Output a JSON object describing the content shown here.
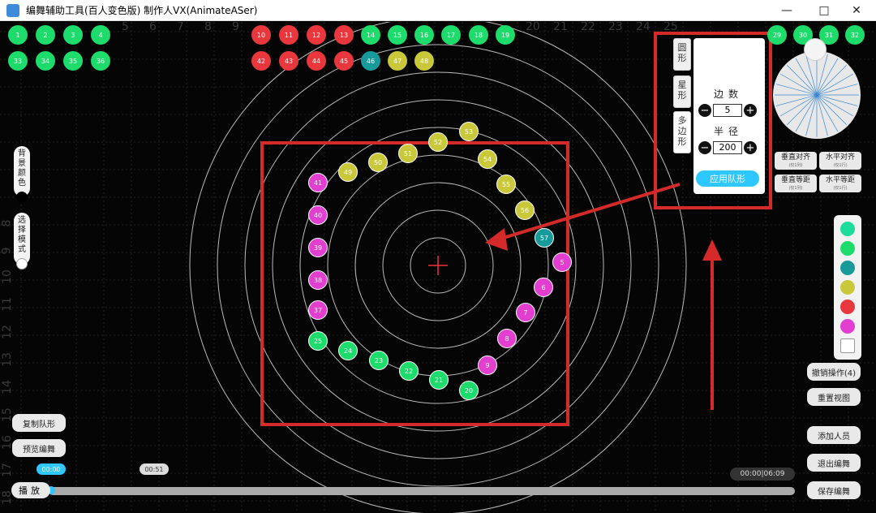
{
  "window": {
    "title": "编舞辅助工具(百人变色版)  制作人VX(AnimateASer)",
    "minimize_icon": "minimize-icon",
    "maximize_icon": "maximize-icon",
    "close_icon": "close-icon"
  },
  "axis": {
    "top_labels": [
      "5",
      "6",
      "7",
      "8",
      "9",
      "20",
      "21",
      "22",
      "23",
      "24",
      "25"
    ],
    "left_labels": [
      "8",
      "9",
      "10",
      "11",
      "12",
      "13",
      "14",
      "15",
      "16",
      "17",
      "18"
    ]
  },
  "dancers": [
    {
      "n": "1",
      "c": "#1ddc6c"
    },
    {
      "n": "2",
      "c": "#1ddc6c"
    },
    {
      "n": "3",
      "c": "#1ddc6c"
    },
    {
      "n": "4",
      "c": "#1ddc6c"
    },
    {
      "n": "10",
      "c": "#e8383d"
    },
    {
      "n": "11",
      "c": "#e8383d"
    },
    {
      "n": "12",
      "c": "#e8383d"
    },
    {
      "n": "13",
      "c": "#e8383d"
    },
    {
      "n": "14",
      "c": "#1ddc6c"
    },
    {
      "n": "15",
      "c": "#1ddc6c"
    },
    {
      "n": "16",
      "c": "#1ddc6c"
    },
    {
      "n": "17",
      "c": "#1ddc6c"
    },
    {
      "n": "18",
      "c": "#1ddc6c"
    },
    {
      "n": "19",
      "c": "#1ddc6c"
    },
    {
      "n": "33",
      "c": "#1ddc6c"
    },
    {
      "n": "34",
      "c": "#1ddc6c"
    },
    {
      "n": "35",
      "c": "#1ddc6c"
    },
    {
      "n": "36",
      "c": "#1ddc6c"
    },
    {
      "n": "42",
      "c": "#e8383d"
    },
    {
      "n": "43",
      "c": "#e8383d"
    },
    {
      "n": "44",
      "c": "#e8383d"
    },
    {
      "n": "45",
      "c": "#e8383d"
    },
    {
      "n": "46",
      "c": "#179a9a"
    },
    {
      "n": "47",
      "c": "#c9c83a"
    },
    {
      "n": "48",
      "c": "#c9c83a"
    },
    {
      "n": "29",
      "c": "#1ddc6c"
    },
    {
      "n": "30",
      "c": "#1ddc6c"
    },
    {
      "n": "31",
      "c": "#1ddc6c"
    },
    {
      "n": "32",
      "c": "#1ddc6c"
    },
    {
      "n": "53",
      "c": "#c9c83a"
    },
    {
      "n": "52",
      "c": "#c9c83a"
    },
    {
      "n": "51",
      "c": "#c9c83a"
    },
    {
      "n": "50",
      "c": "#c9c83a"
    },
    {
      "n": "49",
      "c": "#c9c83a"
    },
    {
      "n": "54",
      "c": "#c9c83a"
    },
    {
      "n": "55",
      "c": "#c9c83a"
    },
    {
      "n": "56",
      "c": "#c9c83a"
    },
    {
      "n": "57",
      "c": "#179a9a"
    },
    {
      "n": "5",
      "c": "#e23fd0"
    },
    {
      "n": "6",
      "c": "#e23fd0"
    },
    {
      "n": "7",
      "c": "#e23fd0"
    },
    {
      "n": "8",
      "c": "#e23fd0"
    },
    {
      "n": "9",
      "c": "#e23fd0"
    },
    {
      "n": "20",
      "c": "#1ddc6c"
    },
    {
      "n": "21",
      "c": "#1ddc6c"
    },
    {
      "n": "22",
      "c": "#1ddc6c"
    },
    {
      "n": "23",
      "c": "#1ddc6c"
    },
    {
      "n": "24",
      "c": "#1ddc6c"
    },
    {
      "n": "25",
      "c": "#1ddc6c"
    },
    {
      "n": "37",
      "c": "#e23fd0"
    },
    {
      "n": "38",
      "c": "#e23fd0"
    },
    {
      "n": "39",
      "c": "#e23fd0"
    },
    {
      "n": "40",
      "c": "#e23fd0"
    },
    {
      "n": "41",
      "c": "#e23fd0"
    }
  ],
  "left_panel": {
    "bg_color_label": "背景颜色",
    "select_mode_label": "选择模式"
  },
  "formation_panel": {
    "tab_circle": "圆形",
    "tab_star": "星形",
    "tab_polygon": "多边形",
    "sides_label": "边数",
    "sides_value": "5",
    "radius_label": "半径",
    "radius_value": "200",
    "apply_label": "应用队形"
  },
  "align": {
    "v_align": "垂直对齐",
    "h_align": "水平对齐",
    "v_space": "垂直等距",
    "h_space": "水平等距",
    "v_sub": "(仅1列)",
    "h_sub": "(仅1行)"
  },
  "swatches": [
    "#1ddc9c",
    "#1ddc6c",
    "#179a9a",
    "#c9c83a",
    "#e8383d",
    "#e23fd0",
    "#ffffff"
  ],
  "right_buttons": {
    "undo": "撤销操作(4)",
    "reset_view": "重置视图",
    "add_person": "添加人员",
    "exit_edit": "退出编舞",
    "save_edit": "保存编舞"
  },
  "left_buttons": {
    "copy_formation": "复制队形",
    "preview": "预览编舞"
  },
  "playback": {
    "play_label": "播放",
    "current_tag": "00:00",
    "marker_tag": "00:51",
    "time_display": "00:00|06:09"
  }
}
